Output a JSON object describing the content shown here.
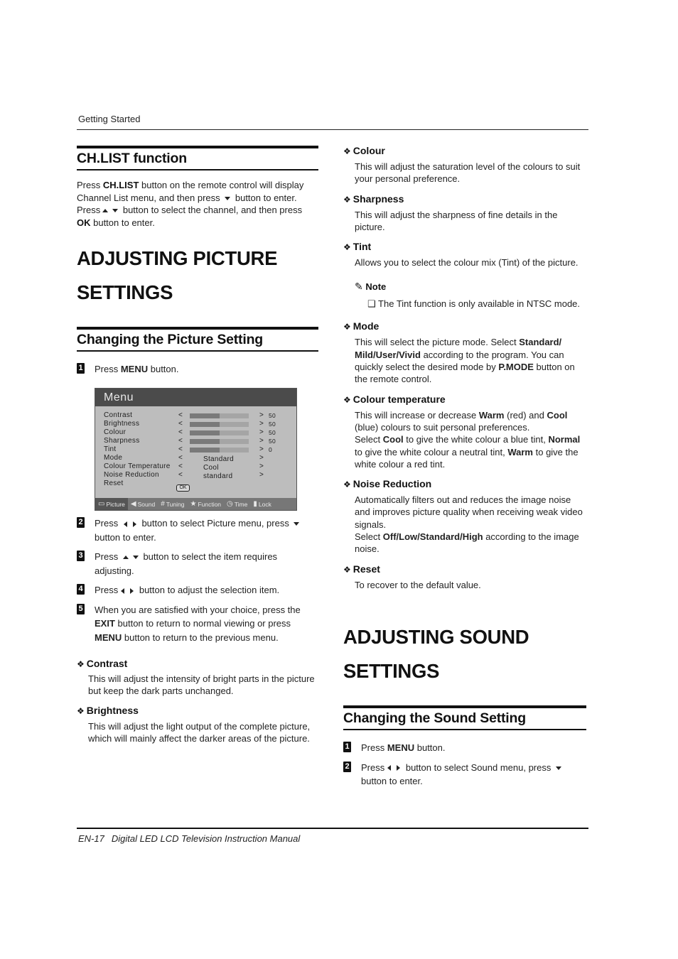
{
  "running_head": "Getting Started",
  "footer": {
    "page": "EN-17",
    "title": "Digital LED LCD Television Instruction Manual"
  },
  "chlist": {
    "heading": "CH.LIST function",
    "p1_a": "Press ",
    "p1_b": "CH.LIST",
    "p1_c": " button on the remote control will display Channel List menu, and then press ",
    "p1_d": " button to enter.",
    "p2_a": "Press",
    "p2_b": " button to select the channel, and then press ",
    "p2_c": "OK",
    "p2_d": " button to enter."
  },
  "picture": {
    "title_line1": "ADJUSTING PICTURE",
    "title_line2": "SETTINGS",
    "subheading": "Changing the Picture Setting",
    "steps": [
      {
        "num": "1",
        "a": "Press ",
        "b": "MENU",
        "c": " button."
      },
      {
        "num": "2",
        "a": "Press ",
        "b": " button to select Picture menu, press ",
        "c": " button to enter."
      },
      {
        "num": "3",
        "a": "Press ",
        "b": " button to select the item requires adjusting."
      },
      {
        "num": "4",
        "a": "Press",
        "b": " button to adjust the selection item."
      },
      {
        "num": "5",
        "a": "When you are satisfied with your choice, press the ",
        "b": "EXIT",
        "c": " button to return to normal viewing or press ",
        "d": "MENU",
        "e": " button to return to the previous menu."
      }
    ]
  },
  "tv_menu": {
    "title": "Menu",
    "rows": [
      {
        "label": "Contrast",
        "left": "<",
        "right": ">",
        "level": 50,
        "value": "50"
      },
      {
        "label": "Brightness",
        "left": "<",
        "right": ">",
        "level": 50,
        "value": "50"
      },
      {
        "label": "Colour",
        "left": "<",
        "right": ">",
        "level": 50,
        "value": "50"
      },
      {
        "label": "Sharpness",
        "left": "<",
        "right": ">",
        "level": 50,
        "value": "50"
      },
      {
        "label": "Tint",
        "left": "<",
        "right": ">",
        "level": 50,
        "value": "0"
      },
      {
        "label": "Mode",
        "left": "<",
        "right": ">",
        "option": "Standard"
      },
      {
        "label": "Colour Temperature",
        "left": "<",
        "right": ">",
        "option": "Cool"
      },
      {
        "label": "Noise Reduction",
        "left": "<",
        "right": ">",
        "option": "standard"
      },
      {
        "label": "Reset",
        "button": "OK"
      }
    ],
    "tabs": [
      {
        "label": "Picture",
        "icon": "picture-icon",
        "active": true
      },
      {
        "label": "Sound",
        "icon": "speaker-icon"
      },
      {
        "label": "Tuning",
        "icon": "grid-icon"
      },
      {
        "label": "Function",
        "icon": "star-icon"
      },
      {
        "label": "Time",
        "icon": "clock-icon"
      },
      {
        "label": "Lock",
        "icon": "lock-icon"
      }
    ]
  },
  "features_left": [
    {
      "title": "Contrast",
      "body": "This will adjust the intensity of bright parts in the picture but keep the dark parts unchanged."
    },
    {
      "title": "Brightness",
      "body": "This will adjust the light output of the complete picture, which will mainly affect the darker areas of the picture."
    }
  ],
  "features_right": {
    "colour": {
      "title": "Colour",
      "body": "This will adjust the saturation level of the colours to suit your personal preference."
    },
    "sharpness": {
      "title": "Sharpness",
      "body": "This will adjust the sharpness of fine details in the picture."
    },
    "tint": {
      "title": "Tint",
      "body": "Allows you to select the colour mix (Tint) of the picture."
    },
    "note": {
      "label": "Note",
      "item": "The Tint function is only available in NTSC mode."
    },
    "mode": {
      "title": "Mode",
      "a": "This will select the picture mode. Select ",
      "b": "Standard/ Mild/User/Vivid",
      "c": " according to the program. You can quickly select the desired mode by ",
      "d": "P.MODE",
      "e": " button on the remote control."
    },
    "colour_temp": {
      "title": "Colour temperature",
      "a": "This will increase or decrease ",
      "b": "Warm",
      "c": " (red) and ",
      "d": "Cool",
      "e": " (blue) colours to suit personal preferences.",
      "f": "Select ",
      "g": "Cool",
      "h": " to give the white colour a blue tint, ",
      "i": "Normal",
      "j": " to give the white colour a neutral tint, ",
      "k": "Warm",
      "l": " to give the white colour a red tint."
    },
    "noise": {
      "title": "Noise Reduction",
      "a": "Automatically filters out and reduces the image noise and improves picture quality when receiving weak video signals.",
      "b": "Select ",
      "c": "Off/Low/Standard/High",
      "d": " according to the image noise."
    },
    "reset": {
      "title": "Reset",
      "body": "To recover to the default value."
    }
  },
  "sound": {
    "title_line1": "ADJUSTING SOUND",
    "title_line2": "SETTINGS",
    "subheading": "Changing the Sound Setting",
    "steps": [
      {
        "num": "1",
        "a": "Press ",
        "b": "MENU",
        "c": " button."
      },
      {
        "num": "2",
        "a": "Press",
        "b": " button to select Sound menu, press ",
        "c": " button to enter."
      }
    ]
  }
}
